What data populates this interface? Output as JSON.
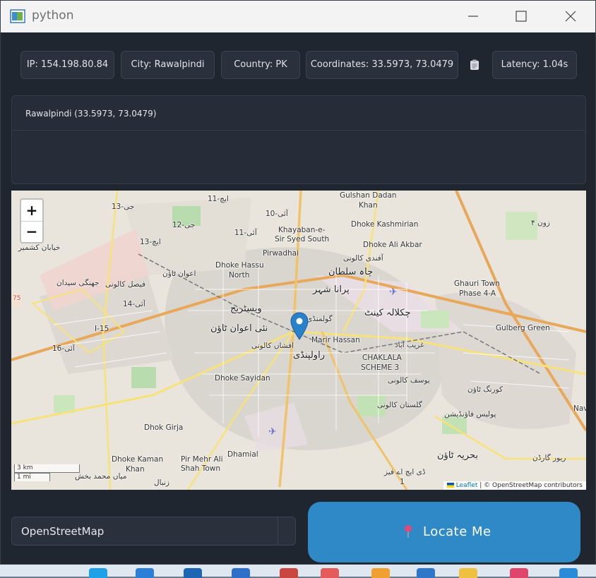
{
  "window": {
    "title": "python",
    "app_icon": "python-window-icon",
    "controls": {
      "minimize": "minimize-icon",
      "maximize": "maximize-icon",
      "close": "close-icon"
    }
  },
  "info_bar": {
    "ip": "IP: 154.198.80.84",
    "city": "City: Rawalpindi",
    "country": "Country: PK",
    "coordinates": "Coordinates: 33.5973, 73.0479",
    "copy_icon": "clipboard-icon",
    "latency": "Latency: 1.04s"
  },
  "location_panel": {
    "line": "Rawalpindi (33.5973, 73.0479)"
  },
  "map": {
    "zoom_in": "+",
    "zoom_out": "−",
    "labels": {
      "gulshan": "Gulshan Dadan",
      "khan": "Khan",
      "g13": "جی-13",
      "h11": "ایچ-11",
      "i10": "آئی-10",
      "g12": "جی-12",
      "i11": "آئی-11",
      "h13": "ایچ-13",
      "khayaban_kashmir": "خیابان کشمیر",
      "khayaban_e": "Khayaban-e-",
      "sir_syed": "Sir Syed South",
      "dhoke_kashmirian": "Dhoke Kashmirian",
      "dhoke_ali_akbar": "Dhoke Ali Akbar",
      "pirwadhai": "Pirwadhai",
      "afandi": "آفندی کالونی",
      "zone4": "زون ۴",
      "dhoke_hassu": "Dhoke Hassu",
      "north": "North",
      "awan_town": "اعوان ٹاؤن",
      "chah_sultan": "چاہ سلطان",
      "jhangi": "جھنگی سیدان",
      "faisal": "فیصل کالونی",
      "purana_shehar": "پرانا شہر",
      "ghauri": "Ghauri Town",
      "phase": "Phase 4-A",
      "i14": "آئی-14",
      "westridge": "ویسٹریج",
      "golmandi": "گولمنڈی",
      "chaklala_cantt": "چکلالہ کینٹ",
      "i15": "I-15",
      "naya_awan": "نئی اعوان ٹاؤن",
      "gulberg": "Gulberg Green",
      "i16": "آئی-16",
      "marir": "Marir Hassan",
      "gharib": "غریب آباد",
      "afshan": "افشاں کالونی",
      "rawalpindi": "راولپنڈی",
      "chaklala_scheme": "CHAKLALA",
      "scheme3": "SCHEME 3",
      "dhoke_sayidan": "Dhoke Sayidan",
      "yousaf": "یوسف کالونی",
      "korang": "کورنگ ٹاؤن",
      "gulistan": "گلستان کالونی",
      "police": "پولیس فاؤنڈیشن",
      "nav": "Nav",
      "dhok_girja": "Dhok Girja",
      "dhamial": "Dhamial",
      "dhoke_kaman": "Dhoke Kaman",
      "khan2": "Khan",
      "pir_mehr": "Pir Mehr Ali",
      "shah_town": "Shah Town",
      "bahria": "بحریہ ٹاؤن",
      "river_garden": "ریور گارڈن",
      "dha": "ڈی ایچ اے فیز",
      "one": "1",
      "mian": "میاں محمد بخش",
      "zanbal": "زنبال",
      "seven_five": "75"
    },
    "scale_km": "3 km",
    "scale_mi": "1 mi",
    "attribution_link": "Leaflet",
    "attribution_text": "| © OpenStreetMap contributors",
    "marker_icon": "map-pin-icon"
  },
  "controls": {
    "provider": "OpenStreetMap",
    "locate_icon": "pushpin-icon",
    "locate_label": "Locate Me"
  }
}
